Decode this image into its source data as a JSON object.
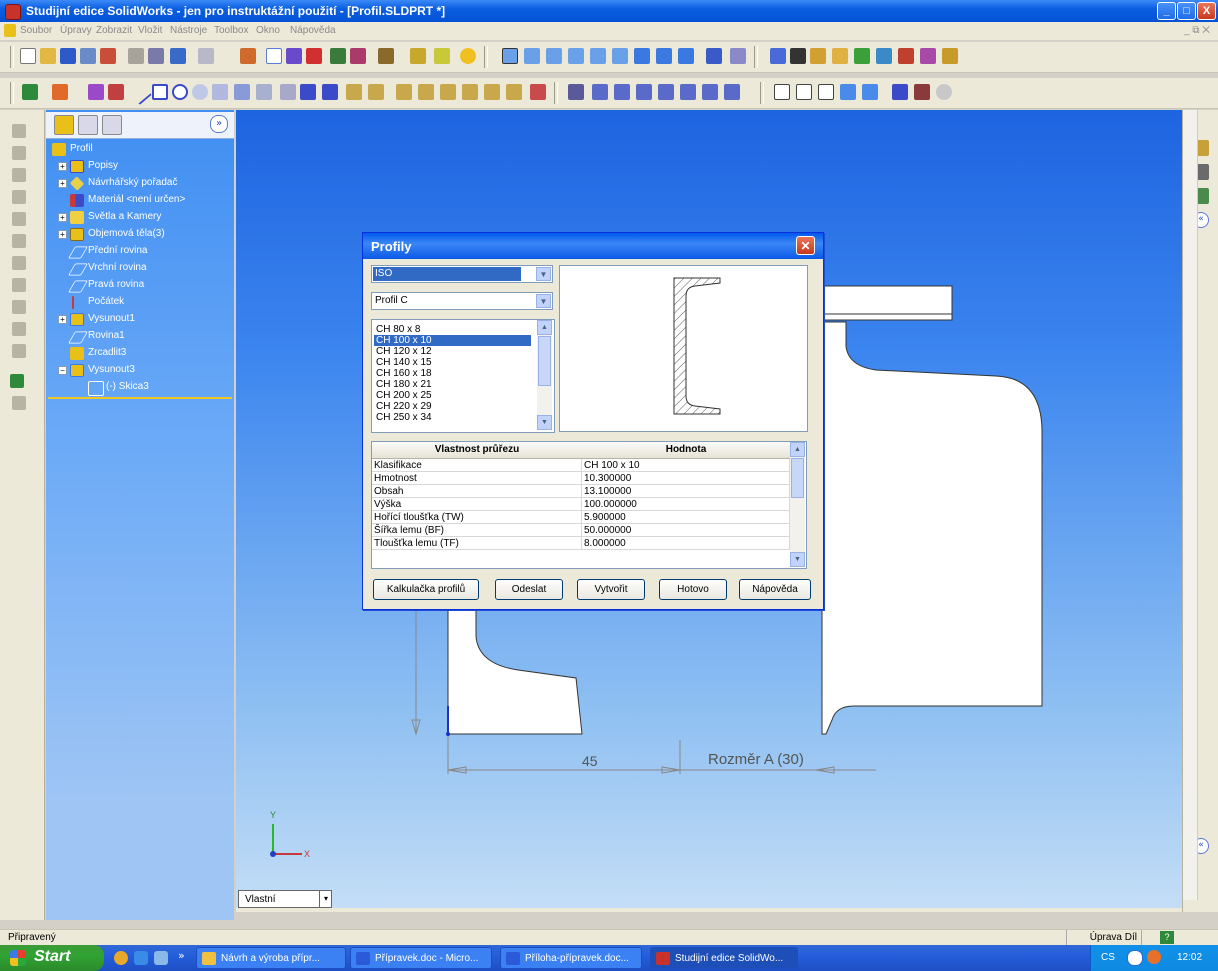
{
  "window": {
    "title": "Studijní edice SolidWorks - jen pro instruktážní použití - [Profil.SLDPRT *]",
    "minimize": "_",
    "maximize": "□",
    "close": "X"
  },
  "menu": {
    "items": [
      "Soubor",
      "Úpravy",
      "Zobrazit",
      "Vložit",
      "Nástroje",
      "Toolbox",
      "Okno",
      "Nápověda"
    ]
  },
  "feature_tree": {
    "expand_button": "»",
    "items": [
      {
        "label": "Profil",
        "icon": "part-icon",
        "expandable": false
      },
      {
        "label": "Popisy",
        "icon": "annotations-icon",
        "expandable": true
      },
      {
        "label": "Návrhářský pořadač",
        "icon": "design-binder-icon",
        "expandable": true
      },
      {
        "label": "Materiál <není určen>",
        "icon": "material-icon",
        "expandable": false
      },
      {
        "label": "Světla a Kamery",
        "icon": "lights-cameras-icon",
        "expandable": true
      },
      {
        "label": "Objemová těla(3)",
        "icon": "solid-bodies-icon",
        "expandable": true
      },
      {
        "label": "Přední rovina",
        "icon": "plane-icon",
        "expandable": false
      },
      {
        "label": "Vrchní rovina",
        "icon": "plane-icon",
        "expandable": false
      },
      {
        "label": "Pravá rovina",
        "icon": "plane-icon",
        "expandable": false
      },
      {
        "label": "Počátek",
        "icon": "origin-icon",
        "expandable": false
      },
      {
        "label": "Vysunout1",
        "icon": "extrude-icon",
        "expandable": true
      },
      {
        "label": "Rovina1",
        "icon": "plane-icon",
        "expandable": false
      },
      {
        "label": "Zrcadlit3",
        "icon": "mirror-icon",
        "expandable": false
      },
      {
        "label": "Vysunout3",
        "icon": "extrude-icon",
        "expandable": true,
        "expanded": true
      },
      {
        "label": "(-) Skica3",
        "icon": "sketch-icon",
        "expandable": false
      }
    ]
  },
  "graphics": {
    "dimension_45": "45",
    "dimension_rozmer": "Rozměr A (30)",
    "axis_y": "Y",
    "axis_x": "X",
    "view_tab": "Vlastní"
  },
  "dialog": {
    "title": "Profily",
    "standard": "ISO",
    "profile_type": "Profil C",
    "sizes": [
      "CH 80 x 8",
      "CH 100 x 10",
      "CH 120 x 12",
      "CH 140 x 15",
      "CH 160 x 18",
      "CH 180 x 21",
      "CH 200 x 25",
      "CH 220 x 29",
      "CH 250 x 34"
    ],
    "selected_size": "CH 100 x 10",
    "table_headers": [
      "Vlastnost průřezu",
      "Hodnota"
    ],
    "table_rows": [
      [
        "Klasifikace",
        "CH 100 x 10"
      ],
      [
        "Hmotnost",
        "10.300000"
      ],
      [
        "Obsah",
        "13.100000"
      ],
      [
        "Výška",
        "100.000000"
      ],
      [
        "Hořící tloušťka (TW)",
        "5.900000"
      ],
      [
        "Šířka lemu (BF)",
        "50.000000"
      ],
      [
        "Tloušťka lemu (TF)",
        "8.000000"
      ]
    ],
    "buttons": {
      "calculator": "Kalkulačka profilů",
      "send": "Odeslat",
      "create": "Vytvořit",
      "done": "Hotovo",
      "help": "Nápověda"
    }
  },
  "statusbar": {
    "left": "Připravený",
    "right": "Úprava Díl",
    "help": "?"
  },
  "taskbar": {
    "start": "Start",
    "more": "»",
    "tasks": [
      {
        "label": "Návrh a výroba přípr...",
        "active": false
      },
      {
        "label": "Přípravek.doc - Micro...",
        "active": false
      },
      {
        "label": "Příloha-přípravek.doc...",
        "active": false
      },
      {
        "label": "Studijní edice SolidWo...",
        "active": true
      }
    ],
    "lang": "CS",
    "time": "12:02"
  },
  "colors": {
    "xp_blue": "#0a5fe0",
    "selection": "#316ac5",
    "tree_blue": "#3f8ef2"
  }
}
